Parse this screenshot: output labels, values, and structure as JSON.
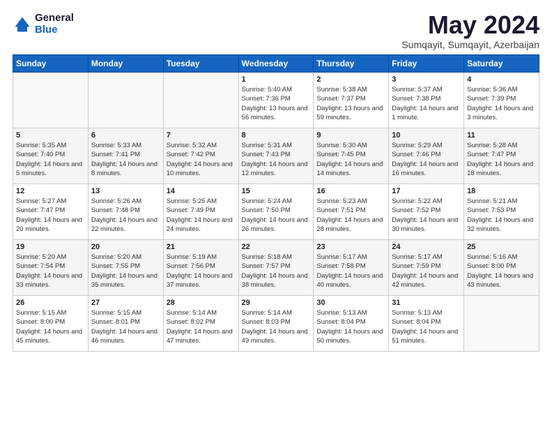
{
  "logo": {
    "general": "General",
    "blue": "Blue"
  },
  "title": "May 2024",
  "location": "Sumqayit, Sumqayit, Azerbaijan",
  "days_of_week": [
    "Sunday",
    "Monday",
    "Tuesday",
    "Wednesday",
    "Thursday",
    "Friday",
    "Saturday"
  ],
  "weeks": [
    [
      {
        "day": "",
        "info": ""
      },
      {
        "day": "",
        "info": ""
      },
      {
        "day": "",
        "info": ""
      },
      {
        "day": "1",
        "info": "Sunrise: 5:40 AM\nSunset: 7:36 PM\nDaylight: 13 hours and 56 minutes."
      },
      {
        "day": "2",
        "info": "Sunrise: 5:38 AM\nSunset: 7:37 PM\nDaylight: 13 hours and 59 minutes."
      },
      {
        "day": "3",
        "info": "Sunrise: 5:37 AM\nSunset: 7:38 PM\nDaylight: 14 hours and 1 minute."
      },
      {
        "day": "4",
        "info": "Sunrise: 5:36 AM\nSunset: 7:39 PM\nDaylight: 14 hours and 3 minutes."
      }
    ],
    [
      {
        "day": "5",
        "info": "Sunrise: 5:35 AM\nSunset: 7:40 PM\nDaylight: 14 hours and 5 minutes."
      },
      {
        "day": "6",
        "info": "Sunrise: 5:33 AM\nSunset: 7:41 PM\nDaylight: 14 hours and 8 minutes."
      },
      {
        "day": "7",
        "info": "Sunrise: 5:32 AM\nSunset: 7:42 PM\nDaylight: 14 hours and 10 minutes."
      },
      {
        "day": "8",
        "info": "Sunrise: 5:31 AM\nSunset: 7:43 PM\nDaylight: 14 hours and 12 minutes."
      },
      {
        "day": "9",
        "info": "Sunrise: 5:30 AM\nSunset: 7:45 PM\nDaylight: 14 hours and 14 minutes."
      },
      {
        "day": "10",
        "info": "Sunrise: 5:29 AM\nSunset: 7:46 PM\nDaylight: 14 hours and 16 minutes."
      },
      {
        "day": "11",
        "info": "Sunrise: 5:28 AM\nSunset: 7:47 PM\nDaylight: 14 hours and 18 minutes."
      }
    ],
    [
      {
        "day": "12",
        "info": "Sunrise: 5:27 AM\nSunset: 7:47 PM\nDaylight: 14 hours and 20 minutes."
      },
      {
        "day": "13",
        "info": "Sunrise: 5:26 AM\nSunset: 7:48 PM\nDaylight: 14 hours and 22 minutes."
      },
      {
        "day": "14",
        "info": "Sunrise: 5:25 AM\nSunset: 7:49 PM\nDaylight: 14 hours and 24 minutes."
      },
      {
        "day": "15",
        "info": "Sunrise: 5:24 AM\nSunset: 7:50 PM\nDaylight: 14 hours and 26 minutes."
      },
      {
        "day": "16",
        "info": "Sunrise: 5:23 AM\nSunset: 7:51 PM\nDaylight: 14 hours and 28 minutes."
      },
      {
        "day": "17",
        "info": "Sunrise: 5:22 AM\nSunset: 7:52 PM\nDaylight: 14 hours and 30 minutes."
      },
      {
        "day": "18",
        "info": "Sunrise: 5:21 AM\nSunset: 7:53 PM\nDaylight: 14 hours and 32 minutes."
      }
    ],
    [
      {
        "day": "19",
        "info": "Sunrise: 5:20 AM\nSunset: 7:54 PM\nDaylight: 14 hours and 33 minutes."
      },
      {
        "day": "20",
        "info": "Sunrise: 5:20 AM\nSunset: 7:55 PM\nDaylight: 14 hours and 35 minutes."
      },
      {
        "day": "21",
        "info": "Sunrise: 5:19 AM\nSunset: 7:56 PM\nDaylight: 14 hours and 37 minutes."
      },
      {
        "day": "22",
        "info": "Sunrise: 5:18 AM\nSunset: 7:57 PM\nDaylight: 14 hours and 38 minutes."
      },
      {
        "day": "23",
        "info": "Sunrise: 5:17 AM\nSunset: 7:58 PM\nDaylight: 14 hours and 40 minutes."
      },
      {
        "day": "24",
        "info": "Sunrise: 5:17 AM\nSunset: 7:59 PM\nDaylight: 14 hours and 42 minutes."
      },
      {
        "day": "25",
        "info": "Sunrise: 5:16 AM\nSunset: 8:00 PM\nDaylight: 14 hours and 43 minutes."
      }
    ],
    [
      {
        "day": "26",
        "info": "Sunrise: 5:15 AM\nSunset: 8:00 PM\nDaylight: 14 hours and 45 minutes."
      },
      {
        "day": "27",
        "info": "Sunrise: 5:15 AM\nSunset: 8:01 PM\nDaylight: 14 hours and 46 minutes."
      },
      {
        "day": "28",
        "info": "Sunrise: 5:14 AM\nSunset: 8:02 PM\nDaylight: 14 hours and 47 minutes."
      },
      {
        "day": "29",
        "info": "Sunrise: 5:14 AM\nSunset: 8:03 PM\nDaylight: 14 hours and 49 minutes."
      },
      {
        "day": "30",
        "info": "Sunrise: 5:13 AM\nSunset: 8:04 PM\nDaylight: 14 hours and 50 minutes."
      },
      {
        "day": "31",
        "info": "Sunrise: 5:13 AM\nSunset: 8:04 PM\nDaylight: 14 hours and 51 minutes."
      },
      {
        "day": "",
        "info": ""
      }
    ]
  ]
}
